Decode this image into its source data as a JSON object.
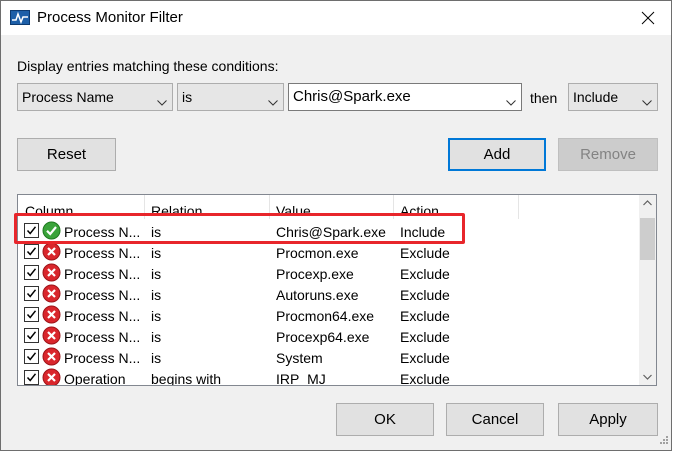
{
  "window": {
    "title": "Process Monitor Filter",
    "app_icon": "process-monitor-icon",
    "close_icon": "close-icon"
  },
  "filter": {
    "instruction": "Display entries matching these conditions:",
    "column_value": "Process Name",
    "relation_value": "is",
    "value_text": "Chris@Spark.exe",
    "then_label": "then",
    "action_value": "Include"
  },
  "buttons": {
    "reset": "Reset",
    "add": "Add",
    "remove": "Remove",
    "ok": "OK",
    "cancel": "Cancel",
    "apply": "Apply"
  },
  "table": {
    "headers": [
      "Column",
      "Relation",
      "Value",
      "Action"
    ],
    "rows": [
      {
        "checked": true,
        "status_icon": "include-check-icon",
        "column": "Process N...",
        "relation": "is",
        "value": "Chris@Spark.exe",
        "action": "Include"
      },
      {
        "checked": true,
        "status_icon": "exclude-x-icon",
        "column": "Process N...",
        "relation": "is",
        "value": "Procmon.exe",
        "action": "Exclude"
      },
      {
        "checked": true,
        "status_icon": "exclude-x-icon",
        "column": "Process N...",
        "relation": "is",
        "value": "Procexp.exe",
        "action": "Exclude"
      },
      {
        "checked": true,
        "status_icon": "exclude-x-icon",
        "column": "Process N...",
        "relation": "is",
        "value": "Autoruns.exe",
        "action": "Exclude"
      },
      {
        "checked": true,
        "status_icon": "exclude-x-icon",
        "column": "Process N...",
        "relation": "is",
        "value": "Procmon64.exe",
        "action": "Exclude"
      },
      {
        "checked": true,
        "status_icon": "exclude-x-icon",
        "column": "Process N...",
        "relation": "is",
        "value": "Procexp64.exe",
        "action": "Exclude"
      },
      {
        "checked": true,
        "status_icon": "exclude-x-icon",
        "column": "Process N...",
        "relation": "is",
        "value": "System",
        "action": "Exclude"
      },
      {
        "checked": true,
        "status_icon": "exclude-x-icon",
        "column": "Operation",
        "relation": "begins with",
        "value": "IRP_MJ_",
        "action": "Exclude"
      }
    ]
  },
  "colors": {
    "highlight": "#e8262b",
    "include": "#3aa33a",
    "exclude": "#d9262c",
    "accent": "#0078d7"
  }
}
